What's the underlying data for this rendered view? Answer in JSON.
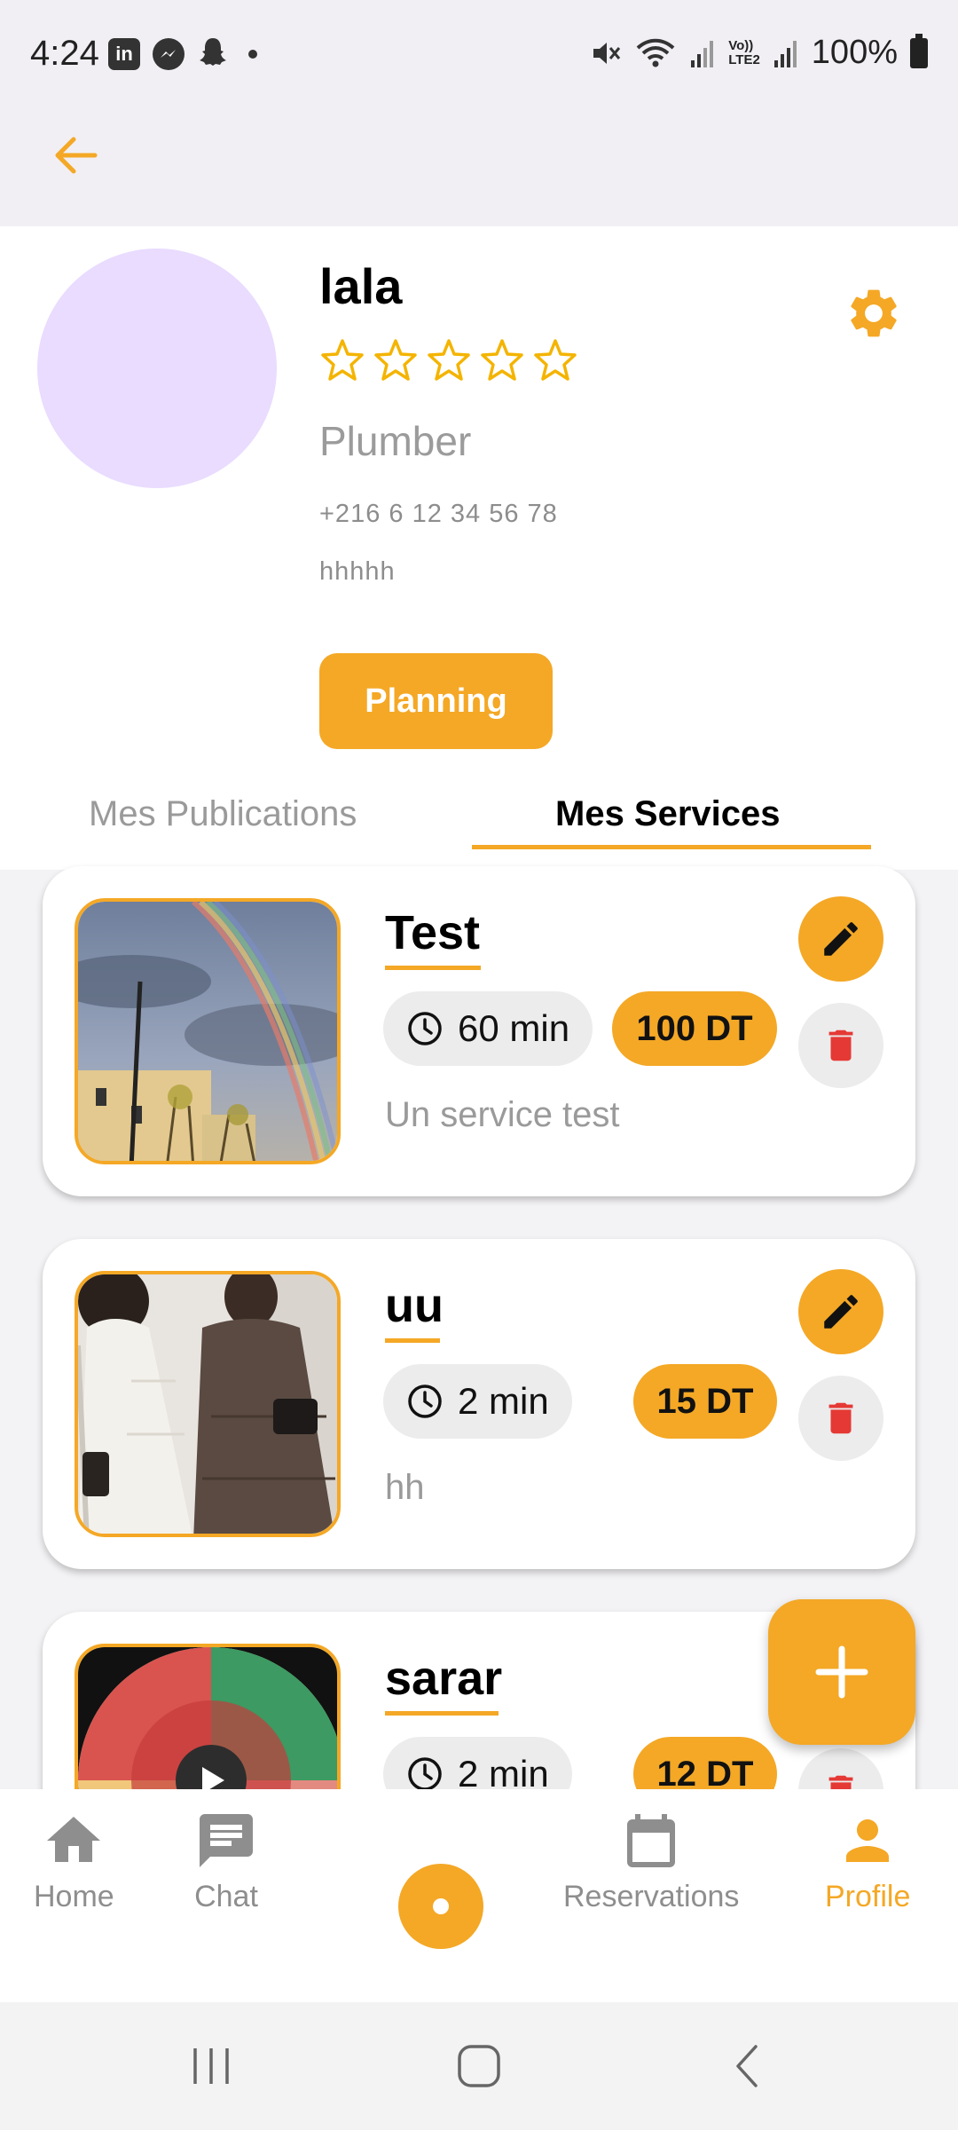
{
  "status_bar": {
    "time": "4:24",
    "battery": "100%",
    "network_badge_top": "Vo))",
    "network_badge_bottom": "LTE2"
  },
  "profile": {
    "name": "lala",
    "rating": 0,
    "rating_max": 5,
    "profession": "Plumber",
    "phone": "+216 6 12 34 56 78",
    "bio": "hhhhh",
    "planning_label": "Planning",
    "avatar_color": "#e9dcff"
  },
  "tabs": [
    {
      "label": "Mes Publications",
      "active": false
    },
    {
      "label": "Mes Services",
      "active": true
    }
  ],
  "services": [
    {
      "title": "Test",
      "duration": "60 min",
      "price": "100 DT",
      "description": "Un service test",
      "image": "rainbow-sky-photo"
    },
    {
      "title": "uu",
      "duration": "2 min",
      "price": "15 DT",
      "description": "hh",
      "image": "two-women-dresses-photo"
    },
    {
      "title": "sarar",
      "duration": "2 min",
      "price": "12 DT",
      "description": "",
      "image": "color-wheel-chart-photo"
    }
  ],
  "bottom_nav": [
    {
      "label": "Home",
      "icon": "home-icon",
      "active": false
    },
    {
      "label": "Chat",
      "icon": "chat-icon",
      "active": false
    },
    {
      "label": "Reservations",
      "icon": "calendar-icon",
      "active": false
    },
    {
      "label": "Profile",
      "icon": "person-icon",
      "active": true
    }
  ],
  "colors": {
    "accent": "#f4a826",
    "delete": "#e53935",
    "muted_text": "#9a9a9a"
  }
}
